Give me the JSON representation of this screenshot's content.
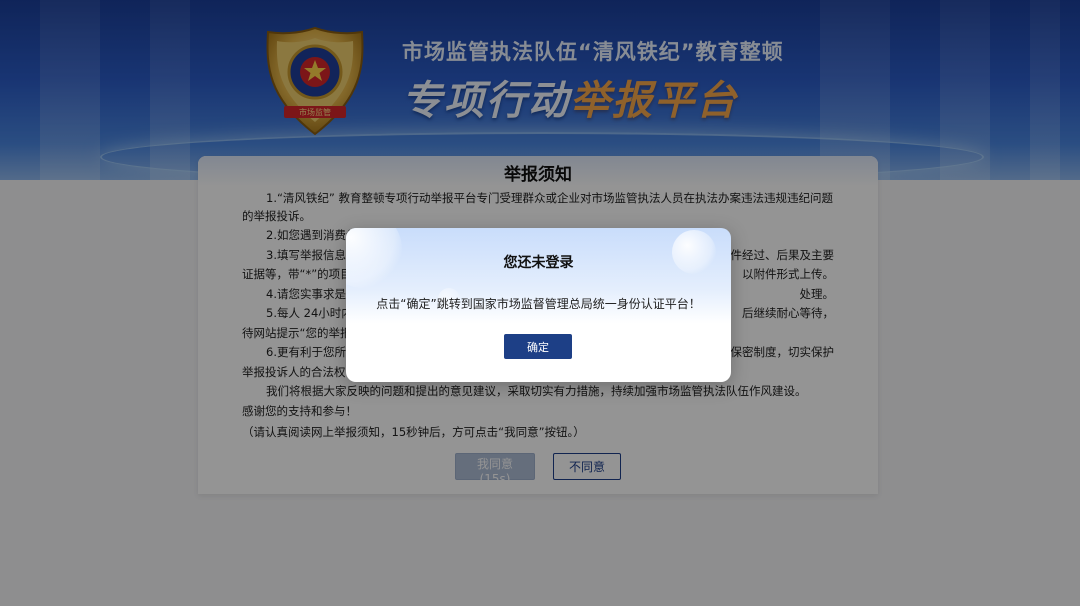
{
  "banner": {
    "subtitle": "市场监管执法队伍“清风铁纪”教育整顿",
    "title_white": "专项行动",
    "title_orange": "举报平台",
    "emblem_text": "市场监管"
  },
  "notice": {
    "heading": "举报须知",
    "paragraphs": [
      "1.“清风铁纪” 教育整顿专项行动举报平台专门受理群众或企业对市场监管执法人员在执法办案违法违规违纪问题的举报投诉。",
      "2.如您遇到消费纠",
      "3.填写举报信息",
      "件经过、后果及主要",
      "证据等，带“*”的项目",
      "以附件形式上传。",
      "4.请您实事求是",
      "处理。",
      "5.每人 24小时内",
      "后继续耐心等待，",
      "待网站提示“您的举报",
      "6.更有利于您所",
      "保密制度，切实保护",
      "举报投诉人的合法权",
      "我们将根据大家反映的问题和提出的意见建议，采取切实有力措施，持续加强市场监管执法队伍作风建设。",
      "感谢您的支持和参与！",
      "（请认真阅读网上举报须知，15秒钟后，方可点击“我同意”按钮。）"
    ],
    "agree_label": "我同意 (15s)",
    "disagree_label": "不同意"
  },
  "modal": {
    "title": "您还未登录",
    "message": "点击“确定”跳转到国家市场监督管理总局统一身份认证平台！",
    "confirm_label": "确定"
  },
  "colors": {
    "banner_blue": "#2b5cc7",
    "title_orange": "#f7a84a",
    "button_navy": "#1d3f86",
    "disabled_button": "#aebdd6"
  }
}
